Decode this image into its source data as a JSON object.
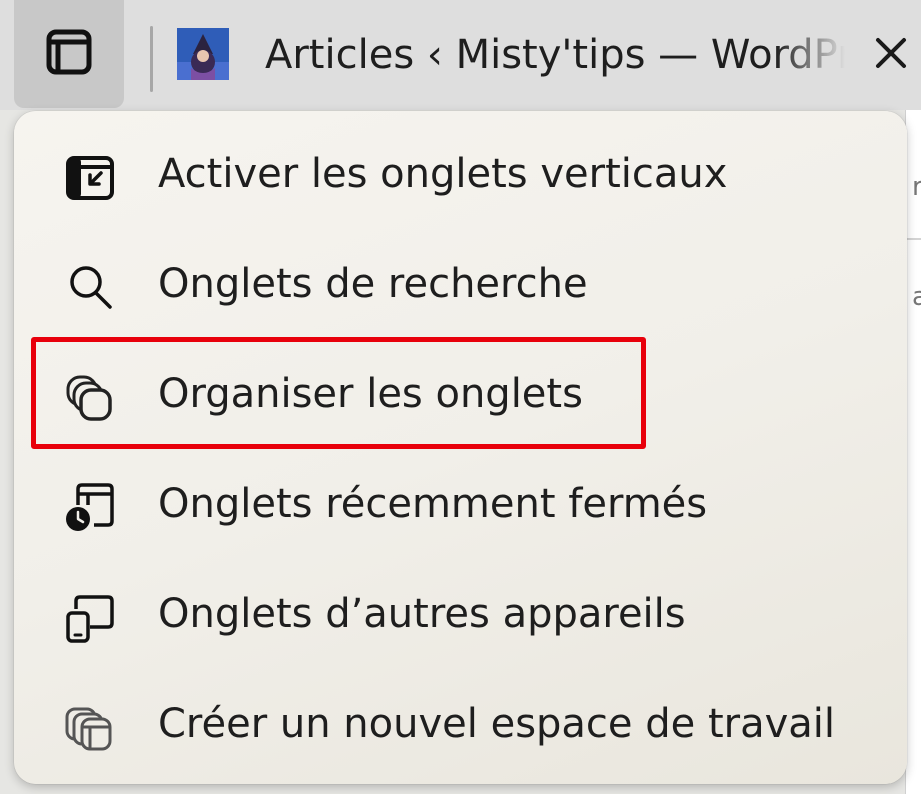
{
  "tab": {
    "title": "Articles ‹ Misty'tips — WordPress"
  },
  "menu": {
    "items": [
      {
        "label": "Activer les onglets verticaux",
        "icon": "vertical-tabs-icon"
      },
      {
        "label": "Onglets de recherche",
        "icon": "search-icon"
      },
      {
        "label": "Organiser les onglets",
        "icon": "organize-tabs-icon"
      },
      {
        "label": "Onglets récemment fermés",
        "icon": "recently-closed-icon"
      },
      {
        "label": "Onglets d’autres appareils",
        "icon": "other-devices-icon"
      },
      {
        "label": "Créer un nouvel espace de travail",
        "icon": "workspace-icon"
      }
    ]
  },
  "colors": {
    "highlight": "#e8000b"
  }
}
